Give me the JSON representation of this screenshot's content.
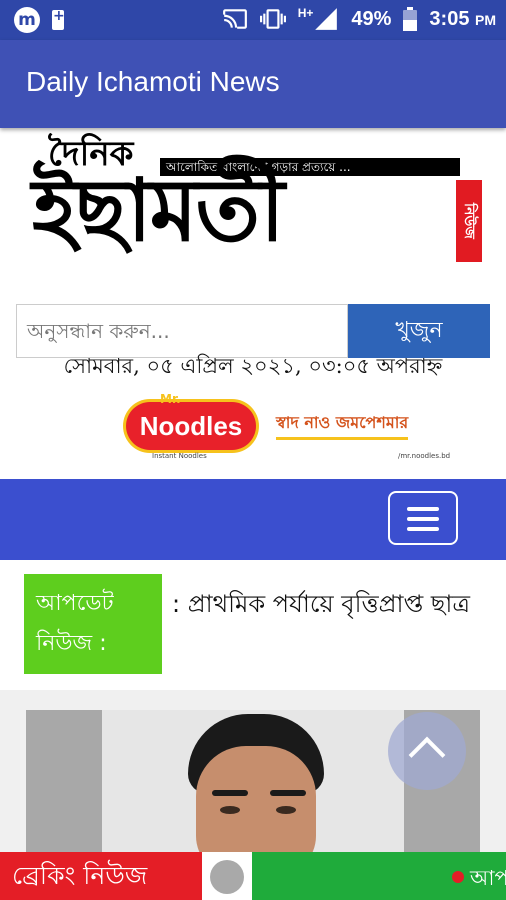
{
  "status_bar": {
    "signal_label": "H+",
    "battery": "49%",
    "time": "3:05",
    "ampm": "PM"
  },
  "app_bar": {
    "title": "Daily Ichamoti News"
  },
  "logo": {
    "top": "দৈনিক",
    "main": "ইছামতী",
    "tagline": "আলোকিত বাংলাদেশ গড়ার প্রত্যয়ে ...",
    "side_badge": "নিউজ"
  },
  "search": {
    "placeholder": "অনুসন্ধান করুন...",
    "button_label": "খুজুন"
  },
  "date_line": "সোমবার, ০৫ এপ্রিল ২০২১, ০৩:০৫ অপরাহ্ন",
  "ad": {
    "brand_prefix": "Mr.",
    "brand": "Noodles",
    "sub": "Instant Noodles",
    "slogan": "স্বাদ নাও জমপেশমার",
    "social": "/mr.noodles.bd"
  },
  "update": {
    "label": "আপডেট নিউজ :",
    "ticker": ": প্রাথমিক পর্যায়ে বৃত্তিপ্রাপ্ত ছাত্র"
  },
  "breaking": {
    "label": "ব্রেকিং নিউজ",
    "ticker": "আপ"
  },
  "colors": {
    "status_bar": "#2f47a8",
    "app_bar": "#3f51b5",
    "nav_band": "#3b4fcf",
    "search_button": "#2e64b8",
    "update_label": "#5ece1e",
    "breaking_red": "#e41e26",
    "breaking_green": "#1fab3b"
  }
}
